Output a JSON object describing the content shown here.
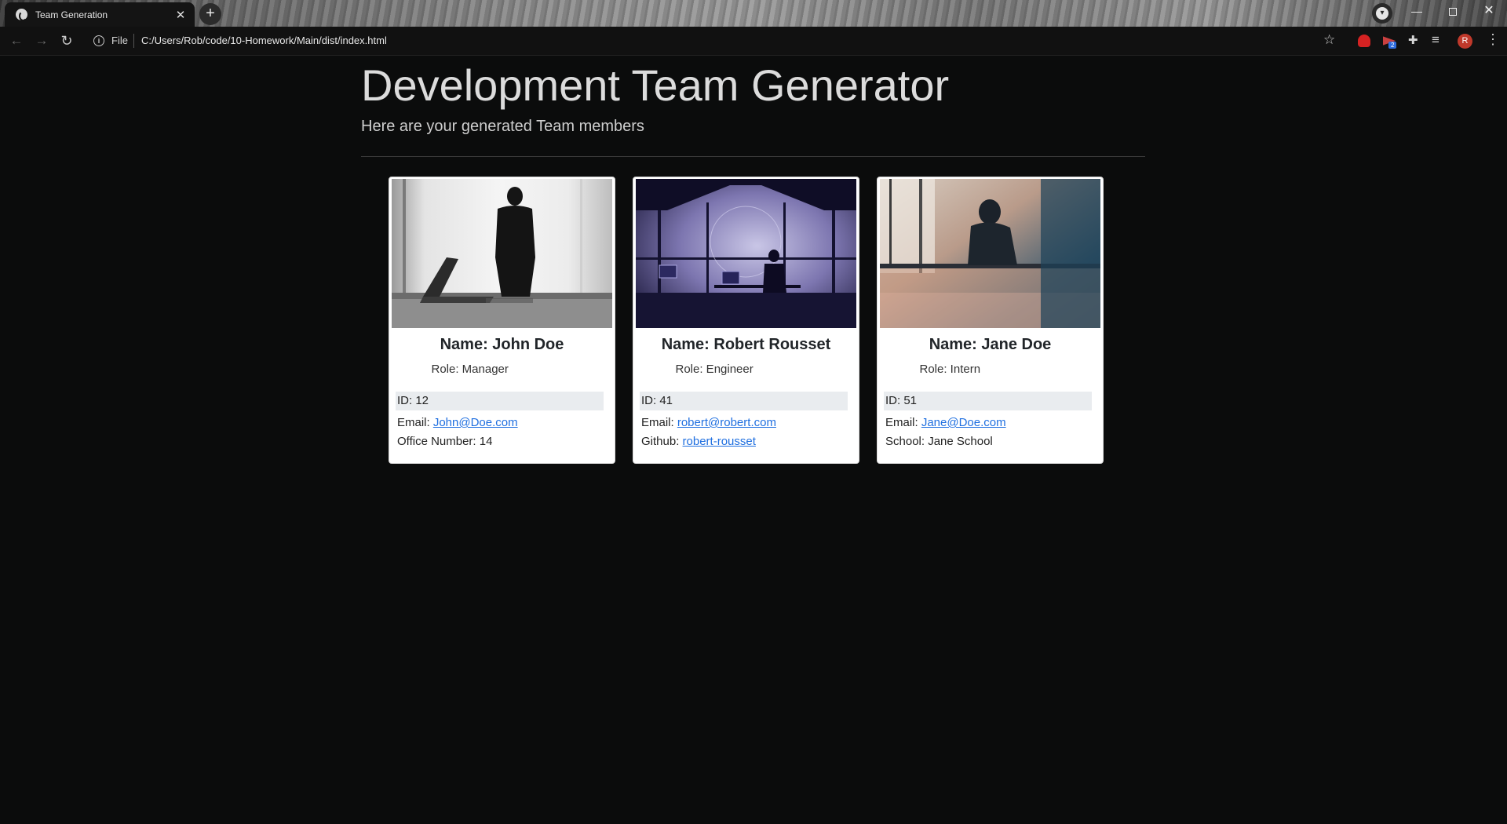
{
  "browser": {
    "tab_title": "Team Generation",
    "tab_close": "✕",
    "new_tab": "+",
    "url_scheme_label": "File",
    "url": "C:/Users/Rob/code/10-Homework/Main/dist/index.html",
    "profile_initial": "R",
    "extension_badge": "2"
  },
  "header": {
    "title": "Development Team Generator",
    "subtitle": "Here are your generated Team members"
  },
  "cards": [
    {
      "name": "Name: John Doe",
      "role": "Role: Manager",
      "id": "ID: 12",
      "email_label": "Email: ",
      "email": "John@Doe.com",
      "extra_label": "Office Number: 14",
      "extra_value": ""
    },
    {
      "name": "Name: Robert Rousset",
      "role": "Role: Engineer",
      "id": "ID: 41",
      "email_label": "Email: ",
      "email": "robert@robert.com",
      "extra_label": "Github: ",
      "extra_value": "robert-rousset"
    },
    {
      "name": "Name: Jane Doe",
      "role": "Role: Intern",
      "id": "ID: 51",
      "email_label": "Email: ",
      "email": "Jane@Doe.com",
      "extra_label": "School: Jane School",
      "extra_value": ""
    }
  ]
}
